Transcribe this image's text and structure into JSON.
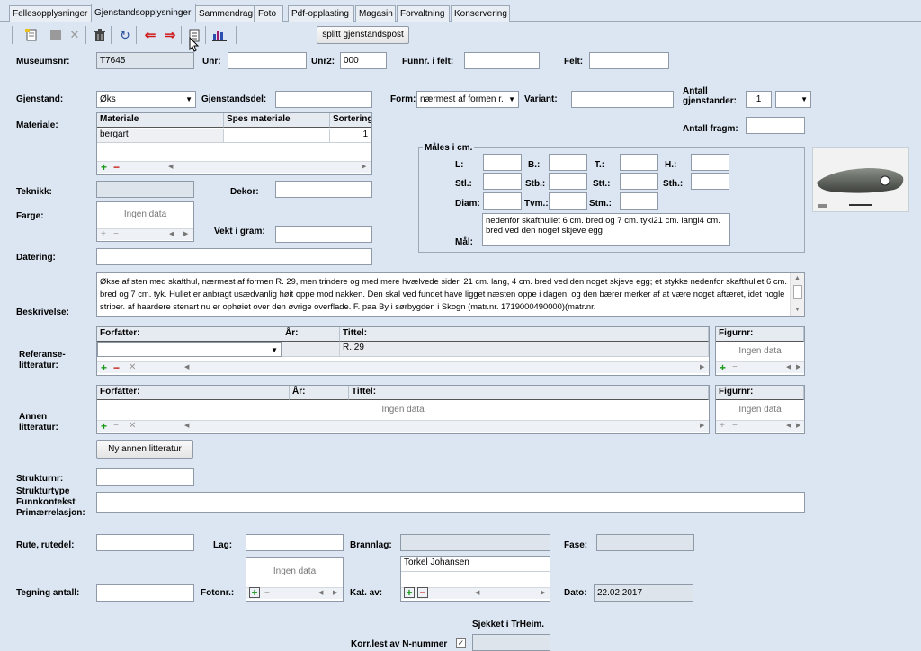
{
  "tabs": [
    "Fellesopplysninger",
    "Gjenstandsopplysninger",
    "Sammendrag",
    "Foto",
    "Pdf-opplasting",
    "Magasin",
    "Forvaltning",
    "Konservering"
  ],
  "toolbar": {
    "split_button": "splitt gjenstandspost"
  },
  "fields": {
    "museumsnr_label": "Museumsnr:",
    "museumsnr_value": "T7645",
    "unr_label": "Unr:",
    "unr_value": "",
    "unr2_label": "Unr2:",
    "unr2_value": "000",
    "funnr_label": "Funnr. i felt:",
    "funnr_value": "",
    "felt_label": "Felt:",
    "felt_value": "",
    "gjenstand_label": "Gjenstand:",
    "gjenstand_value": "Øks",
    "gjenstandsdel_label": "Gjenstandsdel:",
    "gjenstandsdel_value": "",
    "form_label": "Form:",
    "form_value": "nærmest af formen r.",
    "variant_label": "Variant:",
    "variant_value": "",
    "antall_gj_label_1": "Antall",
    "antall_gj_label_2": "gjenstander:",
    "antall_gj_value": "1",
    "antall_fragm_label": "Antall fragm:",
    "antall_fragm_value": "",
    "materiale_label": "Materiale:",
    "teknikk_label": "Teknikk:",
    "dekor_label": "Dekor:",
    "farge_label": "Farge:",
    "vekt_label": "Vekt i gram:",
    "vekt_value": "",
    "datering_label": "Datering:",
    "beskrivelse_label": "Beskrivelse:",
    "ref_label_1": "Referanse-",
    "ref_label_2": "litteratur:",
    "annen_label_1": "Annen",
    "annen_label_2": "litteratur:",
    "ny_annen_button": "Ny annen litteratur",
    "strukturnr_label": "Strukturnr:",
    "strukturtype_label": "Strukturtype",
    "funnkontekst_label": "Funnkontekst",
    "primaer_label": "Primærrelasjon:",
    "rute_label": "Rute, rutedel:",
    "lag_label": "Lag:",
    "brannlag_label": "Brannlag:",
    "fase_label": "Fase:",
    "tegning_label": "Tegning antall:",
    "fotonr_label": "Fotonr.:",
    "katav_label": "Kat. av:",
    "katav_value": "Torkel Johansen",
    "dato_label": "Dato:",
    "dato_value": "22.02.2017",
    "sjekket_label": "Sjekket i TrHeim.",
    "korr_label": "Korr.lest av N-nummer"
  },
  "materiale_grid": {
    "headers": [
      "Materiale",
      "Spes materiale",
      "Sortering"
    ],
    "rows": [
      [
        "bergart",
        "",
        "1"
      ]
    ]
  },
  "males": {
    "title": "Måles i cm.",
    "labels": [
      "L:",
      "B.:",
      "T.:",
      "H.:",
      "Stl.:",
      "Stb.:",
      "Stt.:",
      "Sth.:",
      "Diam:",
      "Tvm.:",
      "Stm.:"
    ],
    "mal_label": "Mål:",
    "mal_value": "nedenfor skafthullet 6 cm. bred og 7 cm. tykl21 cm. langl4 cm. bred ved den noget skjeve egg"
  },
  "beskrivelse": "Økse af sten med skafthul,  nærmest af formen R. 29, men trindere og med mere hvælvede  sider, 21 cm. lang, 4 cm. bred ved den noget skjeve egg; et stykke nedenfor skafthullet 6 cm. bred og 7 cm. tyk. Hullet er anbragt usædvanlig høit oppe mod nakken. Den skal ved fundet have ligget næsten oppe i dagen, og den bærer merker af at være noget aftæret, idet nogle striber. af haardere stenart nu er ophøiet over den øvrige overflade. F. paa By i sørbygden i Skogn (matr.nr. 1719000490000)(matr.nr.",
  "ref_grid": {
    "headers": [
      "Forfatter:",
      "År:",
      "Tittel:"
    ],
    "tittel_value": "R. 29"
  },
  "figur_header": "Figurnr:",
  "annen_grid": {
    "headers": [
      "Forfatter:",
      "År:",
      "Tittel:"
    ]
  },
  "no_data": "Ingen data",
  "icons": [
    "new-record-icon",
    "save-icon",
    "cancel-icon",
    "delete-icon",
    "refresh-icon",
    "previous-icon",
    "next-icon",
    "document-icon",
    "chart-icon",
    "mouse-cursor-icon",
    "scroll-up-icon",
    "scroll-down-icon",
    "scroll-left-icon",
    "scroll-right-icon",
    "dropdown-arrow-icon",
    "checkbox-icon"
  ],
  "colors": {
    "background": "#dbe6f2",
    "add": "#1a9a1a",
    "remove": "#c81414"
  }
}
